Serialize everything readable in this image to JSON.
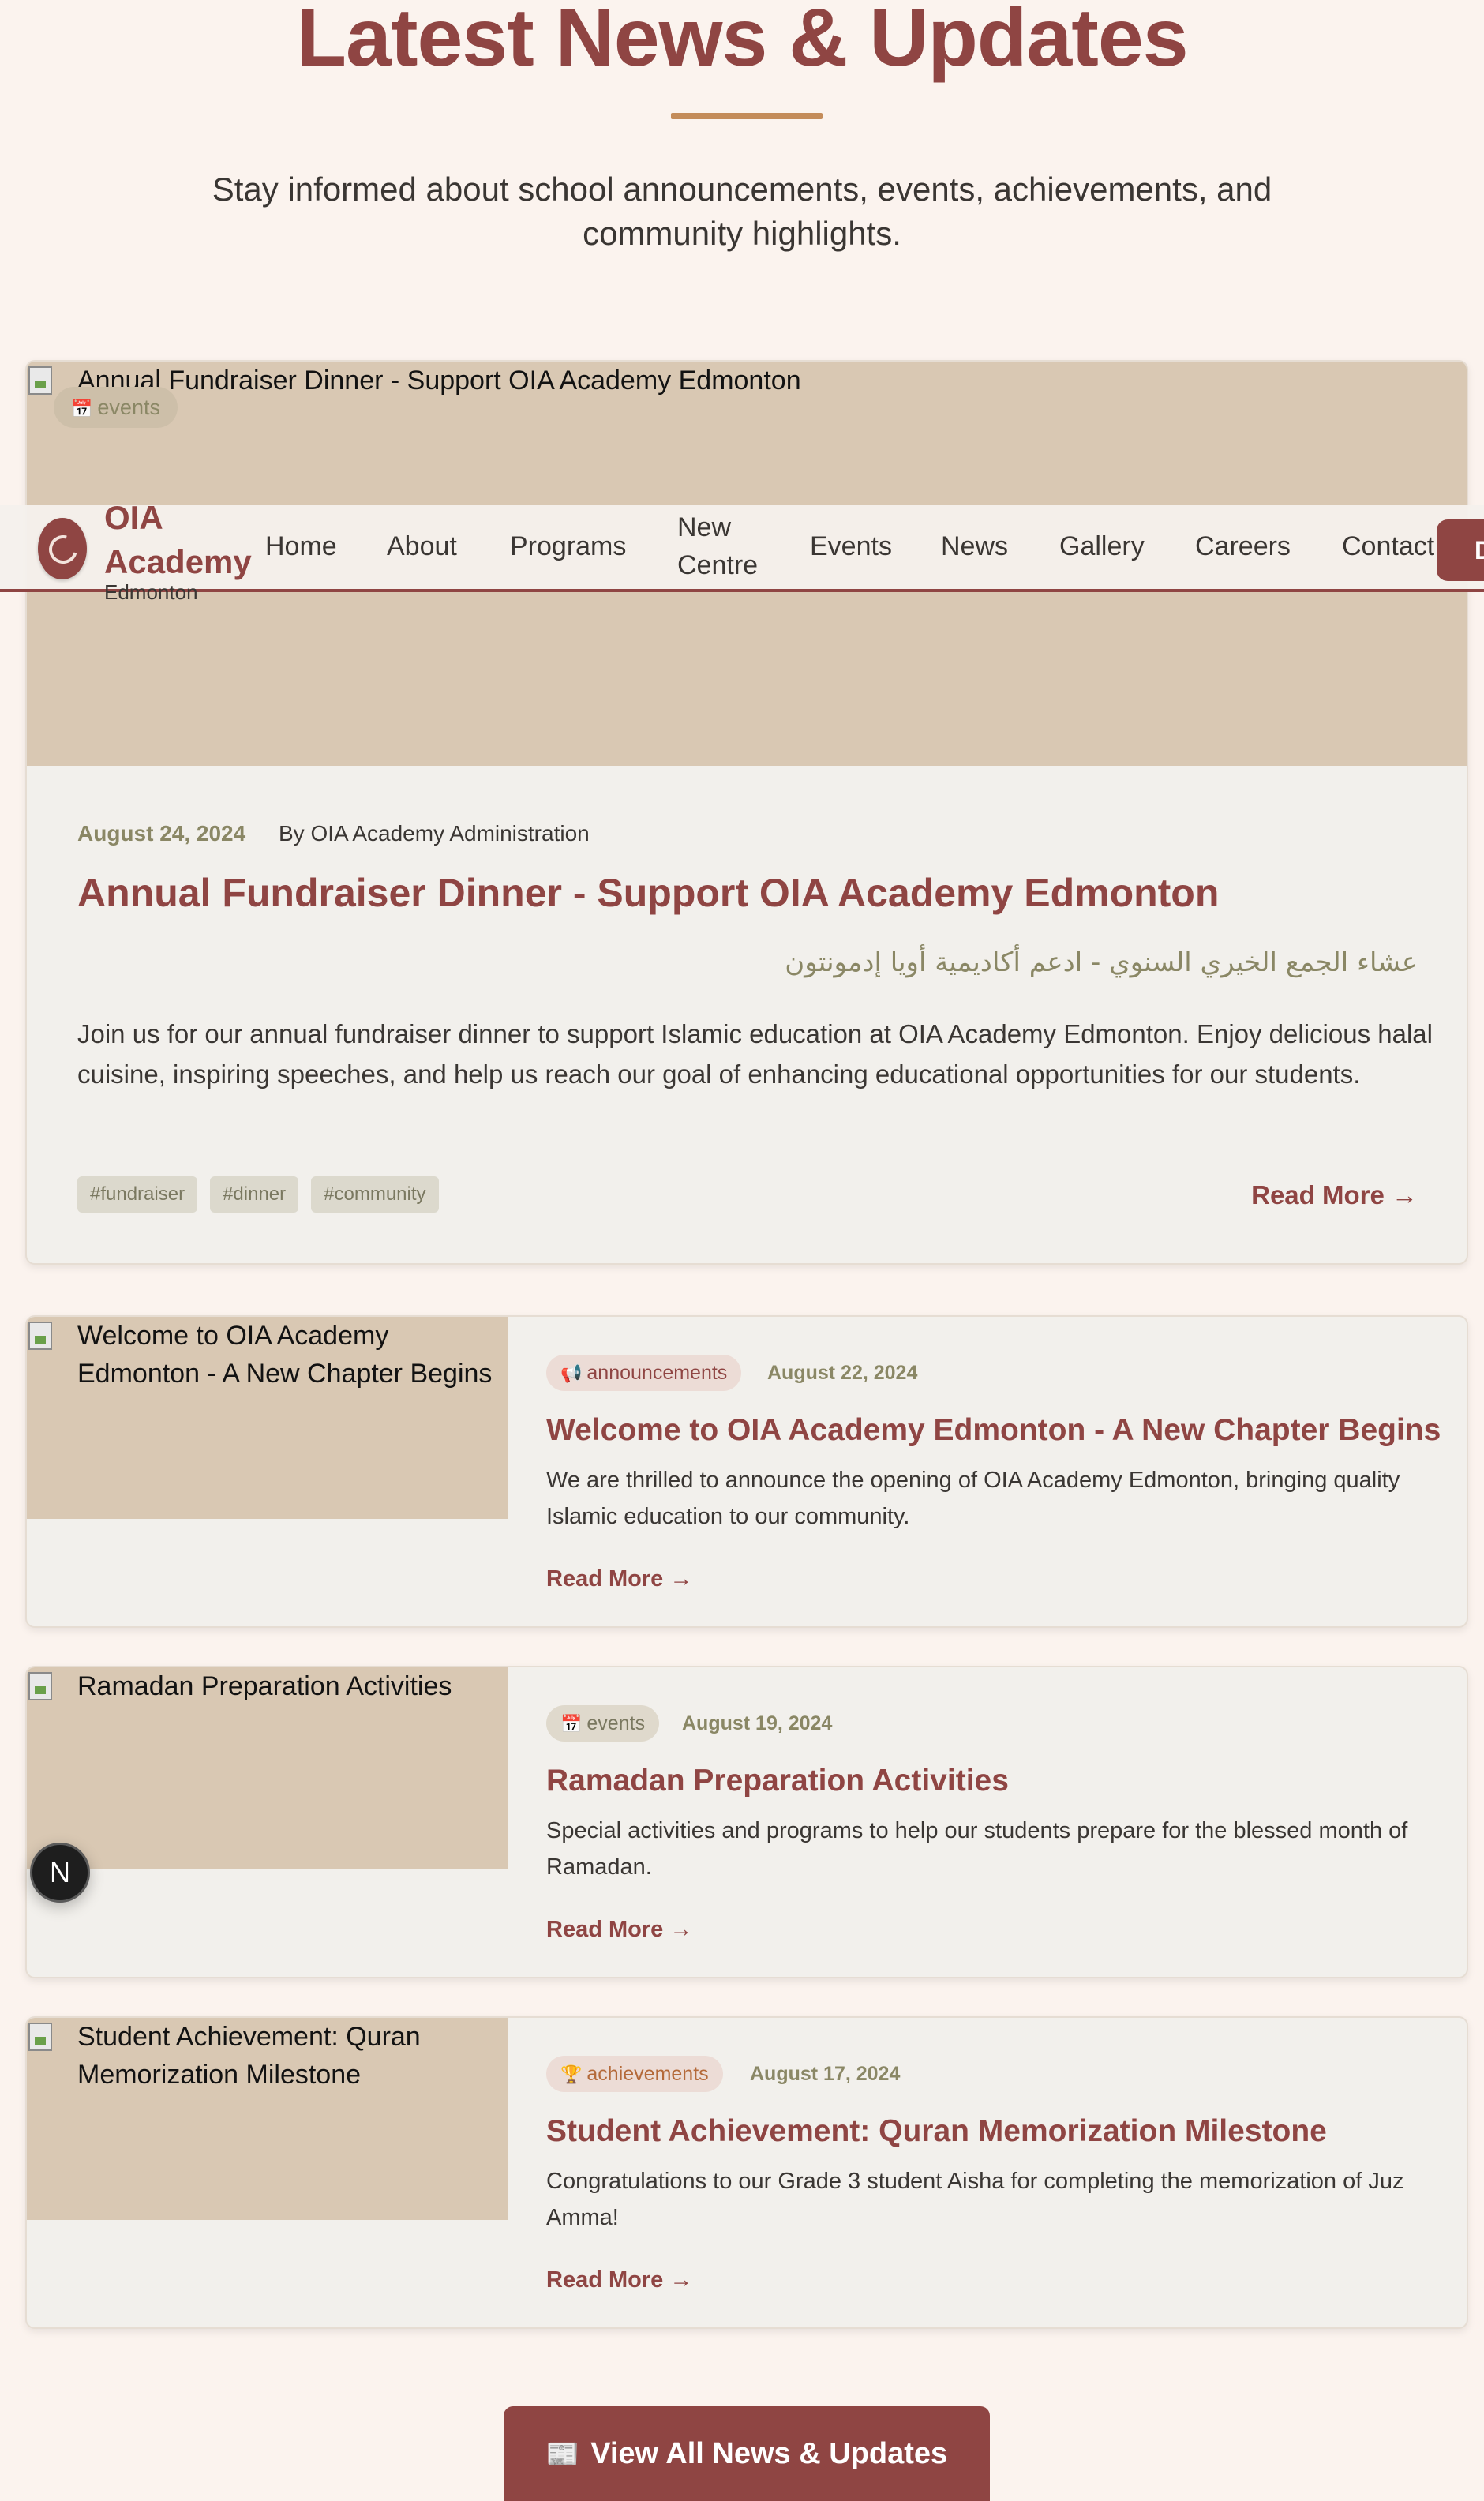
{
  "hero": {
    "title": "Latest News & Updates",
    "subtitle": "Stay informed about school announcements, events, achievements, and community highlights."
  },
  "navbar": {
    "brand_name_line1": "OIA",
    "brand_name_line2": "Academy",
    "brand_sub": "Edmonton",
    "items": [
      "Home",
      "About",
      "Programs",
      "New",
      "Centre",
      "Events",
      "News",
      "Gallery",
      "Careers",
      "Contact"
    ],
    "cta_label": "D"
  },
  "featured": {
    "image_alt": "Annual Fundraiser Dinner - Support OIA Academy Edmonton",
    "category_icon": "calendar-icon",
    "category_glyph": "📅",
    "category": "events",
    "date": "August 24, 2024",
    "author": "By OIA Academy Administration",
    "title": "Annual Fundraiser Dinner - Support OIA Academy Edmonton",
    "arabic_title": "عشاء الجمع الخيري السنوي - ادعم أكاديمية أويا إدمونتون",
    "excerpt": "Join us for our annual fundraiser dinner to support Islamic education at OIA Academy Edmonton. Enjoy delicious halal cuisine, inspiring speeches, and help us reach our goal of enhancing educational opportunities for our students.",
    "tags": [
      "#fundraiser",
      "#dinner",
      "#community"
    ],
    "read_more": "Read More →"
  },
  "articles": [
    {
      "image_alt": "Welcome to OIA Academy Edmonton - A New Chapter Begins",
      "category_icon": "megaphone-icon",
      "category_glyph": "📢",
      "category": "announcements",
      "date": "August 22, 2024",
      "title": "Welcome to OIA Academy Edmonton - A New Chapter Begins",
      "excerpt": "We are thrilled to announce the opening of OIA Academy Edmonton, bringing quality Islamic education to our community.",
      "read_more": "Read More →"
    },
    {
      "image_alt": "Ramadan Preparation Activities",
      "category_icon": "calendar-icon",
      "category_glyph": "📅",
      "category": "events",
      "date": "August 19, 2024",
      "title": "Ramadan Preparation Activities",
      "excerpt": "Special activities and programs to help our students prepare for the blessed month of Ramadan.",
      "read_more": "Read More →"
    },
    {
      "image_alt": "Student Achievement: Quran Memorization Milestone",
      "category_icon": "trophy-icon",
      "category_glyph": "🏆",
      "category": "achievements",
      "date": "August 17, 2024",
      "title": "Student Achievement: Quran Memorization Milestone",
      "excerpt": "Congratulations to our Grade 3 student Aisha for completing the memorization of Juz Amma!",
      "read_more": "Read More →"
    }
  ],
  "floating_badge": "N",
  "view_all": {
    "icon_glyph": "📰",
    "label": "View All News & Updates"
  },
  "colors": {
    "primary": "#8f4543",
    "accent": "#c48c5a",
    "olive": "#8a8765",
    "background": "#fbf3ee",
    "image_placeholder": "#d9c8b3"
  }
}
